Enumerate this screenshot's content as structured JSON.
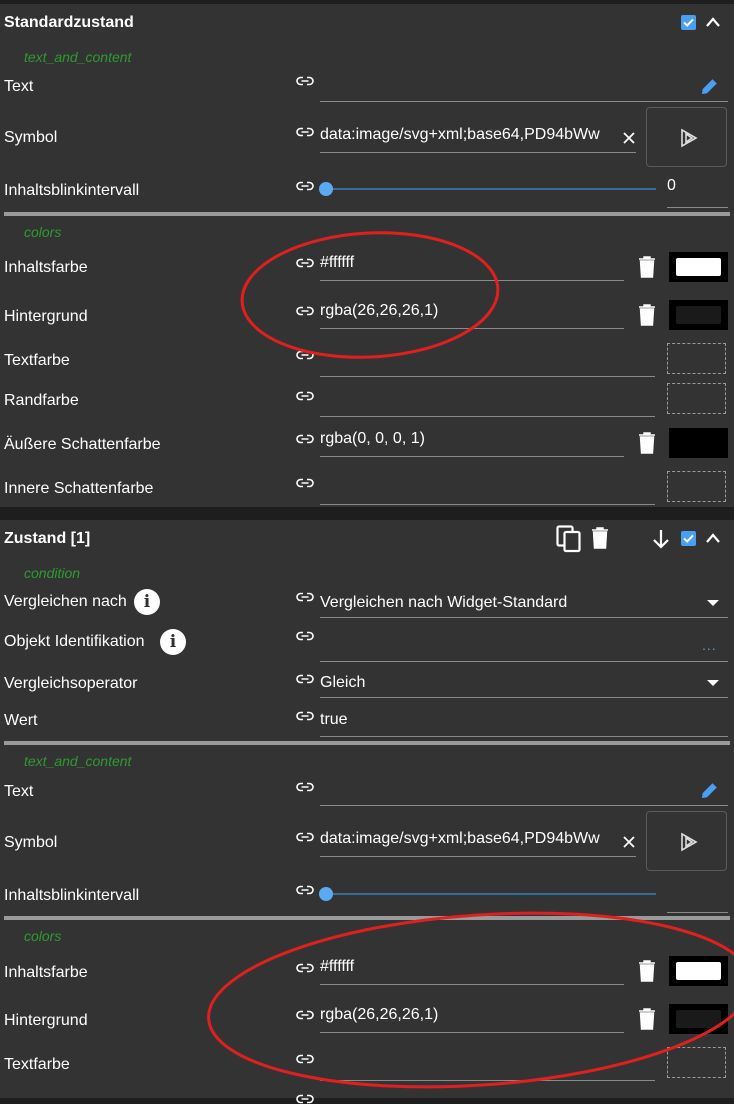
{
  "standard": {
    "title": "Standardzustand",
    "groups": {
      "text": "text_and_content",
      "colors": "colors"
    },
    "labels": {
      "text": "Text",
      "symbol": "Symbol",
      "blink": "Inhaltsblinkintervall",
      "inhaltsfarbe": "Inhaltsfarbe",
      "hintergrund": "Hintergrund",
      "textfarbe": "Textfarbe",
      "randfarbe": "Randfarbe",
      "aussen": "Äußere Schattenfarbe",
      "innen": "Innere Schattenfarbe"
    },
    "values": {
      "symbol": "data:image/svg+xml;base64,PD94bWw",
      "blink": "0",
      "inhaltsfarbe": "#ffffff",
      "hintergrund": "rgba(26,26,26,1)",
      "aussen": "rgba(0, 0, 0, 1)"
    },
    "swatches": {
      "inhaltsfarbe": "#ffffff",
      "hintergrund": "#1a1a1a",
      "aussen": "#000000"
    }
  },
  "state1": {
    "title": "Zustand [1]",
    "groups": {
      "condition": "condition",
      "text": "text_and_content",
      "colors": "colors"
    },
    "labels": {
      "vergleichen": "Vergleichen nach",
      "objekt": "Objekt Identifikation",
      "operator": "Vergleichsoperator",
      "wert": "Wert",
      "text": "Text",
      "symbol": "Symbol",
      "blink": "Inhaltsblinkintervall",
      "inhaltsfarbe": "Inhaltsfarbe",
      "hintergrund": "Hintergrund",
      "textfarbe": "Textfarbe"
    },
    "values": {
      "vergleichen": "Vergleichen nach Widget-Standard",
      "objekt_more": "...",
      "operator": "Gleich",
      "wert": "true",
      "symbol": "data:image/svg+xml;base64,PD94bWw",
      "inhaltsfarbe": "#ffffff",
      "hintergrund": "rgba(26,26,26,1)"
    },
    "swatches": {
      "inhaltsfarbe": "#ffffff",
      "hintergrund": "#1a1a1a"
    }
  },
  "info_glyph": "i",
  "icons": [
    "link-icon",
    "pencil-icon",
    "close-icon",
    "play-icon",
    "trash-icon",
    "copy-icon",
    "arrow-down-icon",
    "chevron-up-icon",
    "checkbox-icon",
    "info-icon"
  ],
  "colors": {
    "accent": "#4a9ff0",
    "group_label": "#2f9a2f",
    "panel": "#333333",
    "annotation": "#e02020"
  }
}
